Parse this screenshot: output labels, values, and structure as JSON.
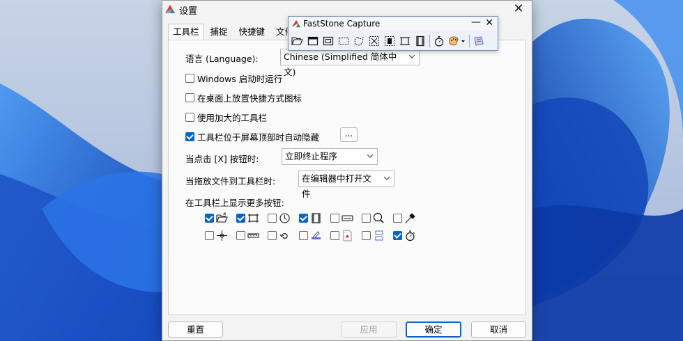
{
  "dialog": {
    "title": "设置",
    "tabs": [
      "工具栏",
      "捕捉",
      "快捷键",
      "文件"
    ],
    "active_tab": 0,
    "language_label": "语言 (Language):",
    "language_value": "Chinese (Simplified 简体中文)",
    "options": [
      {
        "label": "Windows 启动时运行",
        "checked": false
      },
      {
        "label": "在桌面上放置快捷方式图标",
        "checked": false
      },
      {
        "label": "使用加大的工具栏",
        "checked": false
      },
      {
        "label": "工具栏位于屏幕顶部时自动隐藏",
        "checked": true
      }
    ],
    "dots_button": "...",
    "on_close_label": "当点击 [X] 按钮时:",
    "on_close_value": "立即终止程序",
    "on_drop_label": "当拖放文件到工具栏时:",
    "on_drop_value": "在编辑器中打开文件",
    "more_buttons_label": "在工具栏上显示更多按钮:",
    "extra_buttons_row1": [
      {
        "icon": "open-folder-icon",
        "checked": true
      },
      {
        "icon": "fixed-region-icon",
        "checked": true
      },
      {
        "icon": "delay-clock-icon",
        "checked": false
      },
      {
        "icon": "film-strip-icon",
        "checked": true
      },
      {
        "icon": "screen-ruler-icon",
        "checked": false
      },
      {
        "icon": "magnifier-icon",
        "checked": false
      },
      {
        "icon": "color-picker-icon",
        "checked": false
      }
    ],
    "extra_buttons_row2": [
      {
        "icon": "crosshair-icon",
        "checked": false
      },
      {
        "icon": "ruler-icon",
        "checked": false
      },
      {
        "icon": "undo-arrow-icon",
        "checked": false
      },
      {
        "icon": "scanner-icon",
        "checked": false
      },
      {
        "icon": "pdf-icon",
        "checked": false
      },
      {
        "icon": "combine-images-icon",
        "checked": false
      },
      {
        "icon": "timer-icon",
        "checked": true
      }
    ],
    "buttons": {
      "reset": "重置",
      "apply": "应用",
      "ok": "确定",
      "cancel": "取消"
    }
  },
  "faststone": {
    "title": "FastStone Capture",
    "tools": [
      "open-folder-icon",
      "capture-window-icon",
      "capture-object-icon",
      "capture-rectangle-icon",
      "capture-freehand-icon",
      "capture-fullscreen-icon",
      "capture-scrolling-icon",
      "capture-fixed-region-icon",
      "screen-recorder-icon",
      "delay-timer-icon",
      "output-palette-icon",
      "settings-icon"
    ]
  },
  "colors": {
    "accent": "#0a64c8",
    "wallpaper": "#1f5fd6"
  }
}
